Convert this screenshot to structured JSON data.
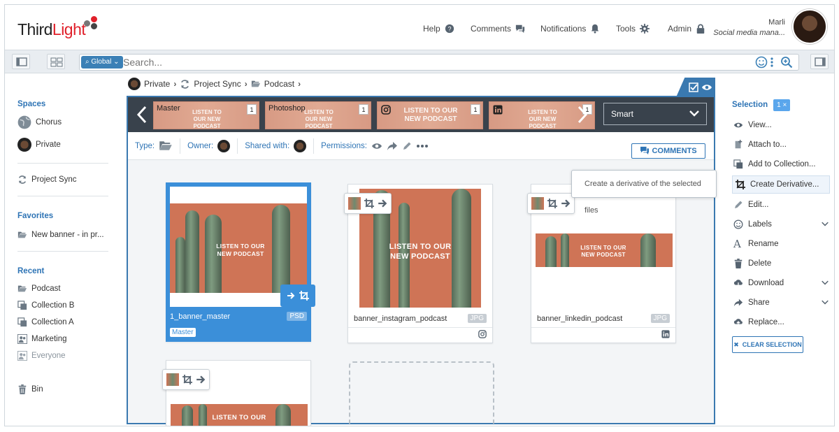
{
  "header": {
    "logo_a": "Third",
    "logo_b": "Light",
    "nav": {
      "help": "Help",
      "comments": "Comments",
      "notifications": "Notifications",
      "tools": "Tools",
      "admin": "Admin"
    },
    "user": {
      "name": "Marli",
      "role": "Social media mana..."
    }
  },
  "search": {
    "scope": "Global",
    "placeholder": "Search..."
  },
  "sidebar": {
    "spaces_title": "Spaces",
    "spaces": [
      "Chorus",
      "Private"
    ],
    "project_sync": "Project Sync",
    "favorites_title": "Favorites",
    "favorites": [
      "New banner - in pr..."
    ],
    "recent_title": "Recent",
    "recent": [
      "Podcast",
      "Collection B",
      "Collection A",
      "Marketing",
      "Everyone"
    ],
    "bin": "Bin"
  },
  "breadcrumb": [
    "Private",
    "Project Sync",
    "Podcast"
  ],
  "strip": {
    "tiles": [
      {
        "label": "Master",
        "count": "1"
      },
      {
        "label": "Photoshop",
        "count": "1"
      },
      {
        "label": "",
        "count": "1"
      },
      {
        "label": "",
        "count": "1"
      }
    ],
    "tile_text": "LISTEN TO OUR NEW PODCAST",
    "view": "Smart"
  },
  "meta": {
    "type": "Type:",
    "owner": "Owner:",
    "shared": "Shared with:",
    "permissions": "Permissions:",
    "comments": "COMMENTS"
  },
  "cards": [
    {
      "name": "1_banner_master",
      "type": "PSD",
      "tag": "Master",
      "photo_text_1": "LISTEN TO OUR",
      "photo_text_2": "NEW PODCAST"
    },
    {
      "name": "banner_instagram_podcast",
      "type": "JPG",
      "photo_text_1": "LISTEN TO OUR",
      "photo_text_2": "NEW PODCAST"
    },
    {
      "name": "banner_linkedin_podcast",
      "type": "JPG",
      "photo_text_1": "LISTEN TO OUR",
      "photo_text_2": "NEW PODCAST"
    },
    {
      "photo_text_1": "LISTEN TO OUR"
    }
  ],
  "tooltip": "Create a derivative of the selected files",
  "selection": {
    "title": "Selection",
    "count": "1 ×",
    "actions": [
      "View...",
      "Attach to...",
      "Add to Collection...",
      "Create Derivative...",
      "Edit...",
      "Labels",
      "Rename",
      "Delete",
      "Download",
      "Share",
      "Replace..."
    ],
    "clear": "CLEAR SELECTION"
  },
  "colors": {
    "accent": "#3b8fd9",
    "brand_red": "#e0202a",
    "dark_strip": "#39424c"
  }
}
